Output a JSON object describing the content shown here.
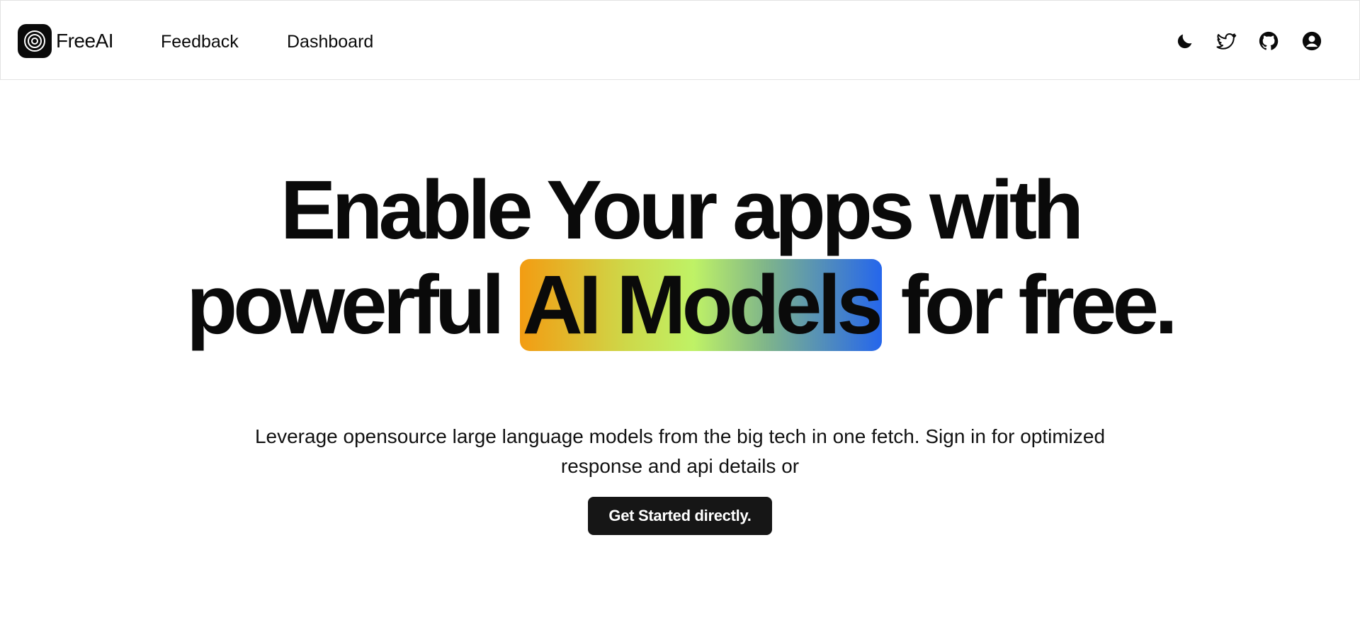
{
  "header": {
    "logo_text": "FreeAI",
    "nav": {
      "feedback": "Feedback",
      "dashboard": "Dashboard"
    },
    "icons": [
      "moon-icon",
      "twitter-icon",
      "github-icon",
      "user-icon"
    ]
  },
  "hero": {
    "headline_line1": "Enable Your apps with",
    "headline_line2_before": "powerful",
    "headline_highlight": "AI Models",
    "headline_line2_after": "for free.",
    "highlight_gradient": [
      "#f39c12",
      "#bff266",
      "#2566ec"
    ],
    "subtitle": "Leverage opensource large language models from the big tech in one fetch. Sign in for optimized response and api details or",
    "cta_label": "Get Started directly."
  },
  "colors": {
    "text": "#0a0a0a",
    "button_bg": "#161616",
    "border": "#e3e3e3"
  }
}
